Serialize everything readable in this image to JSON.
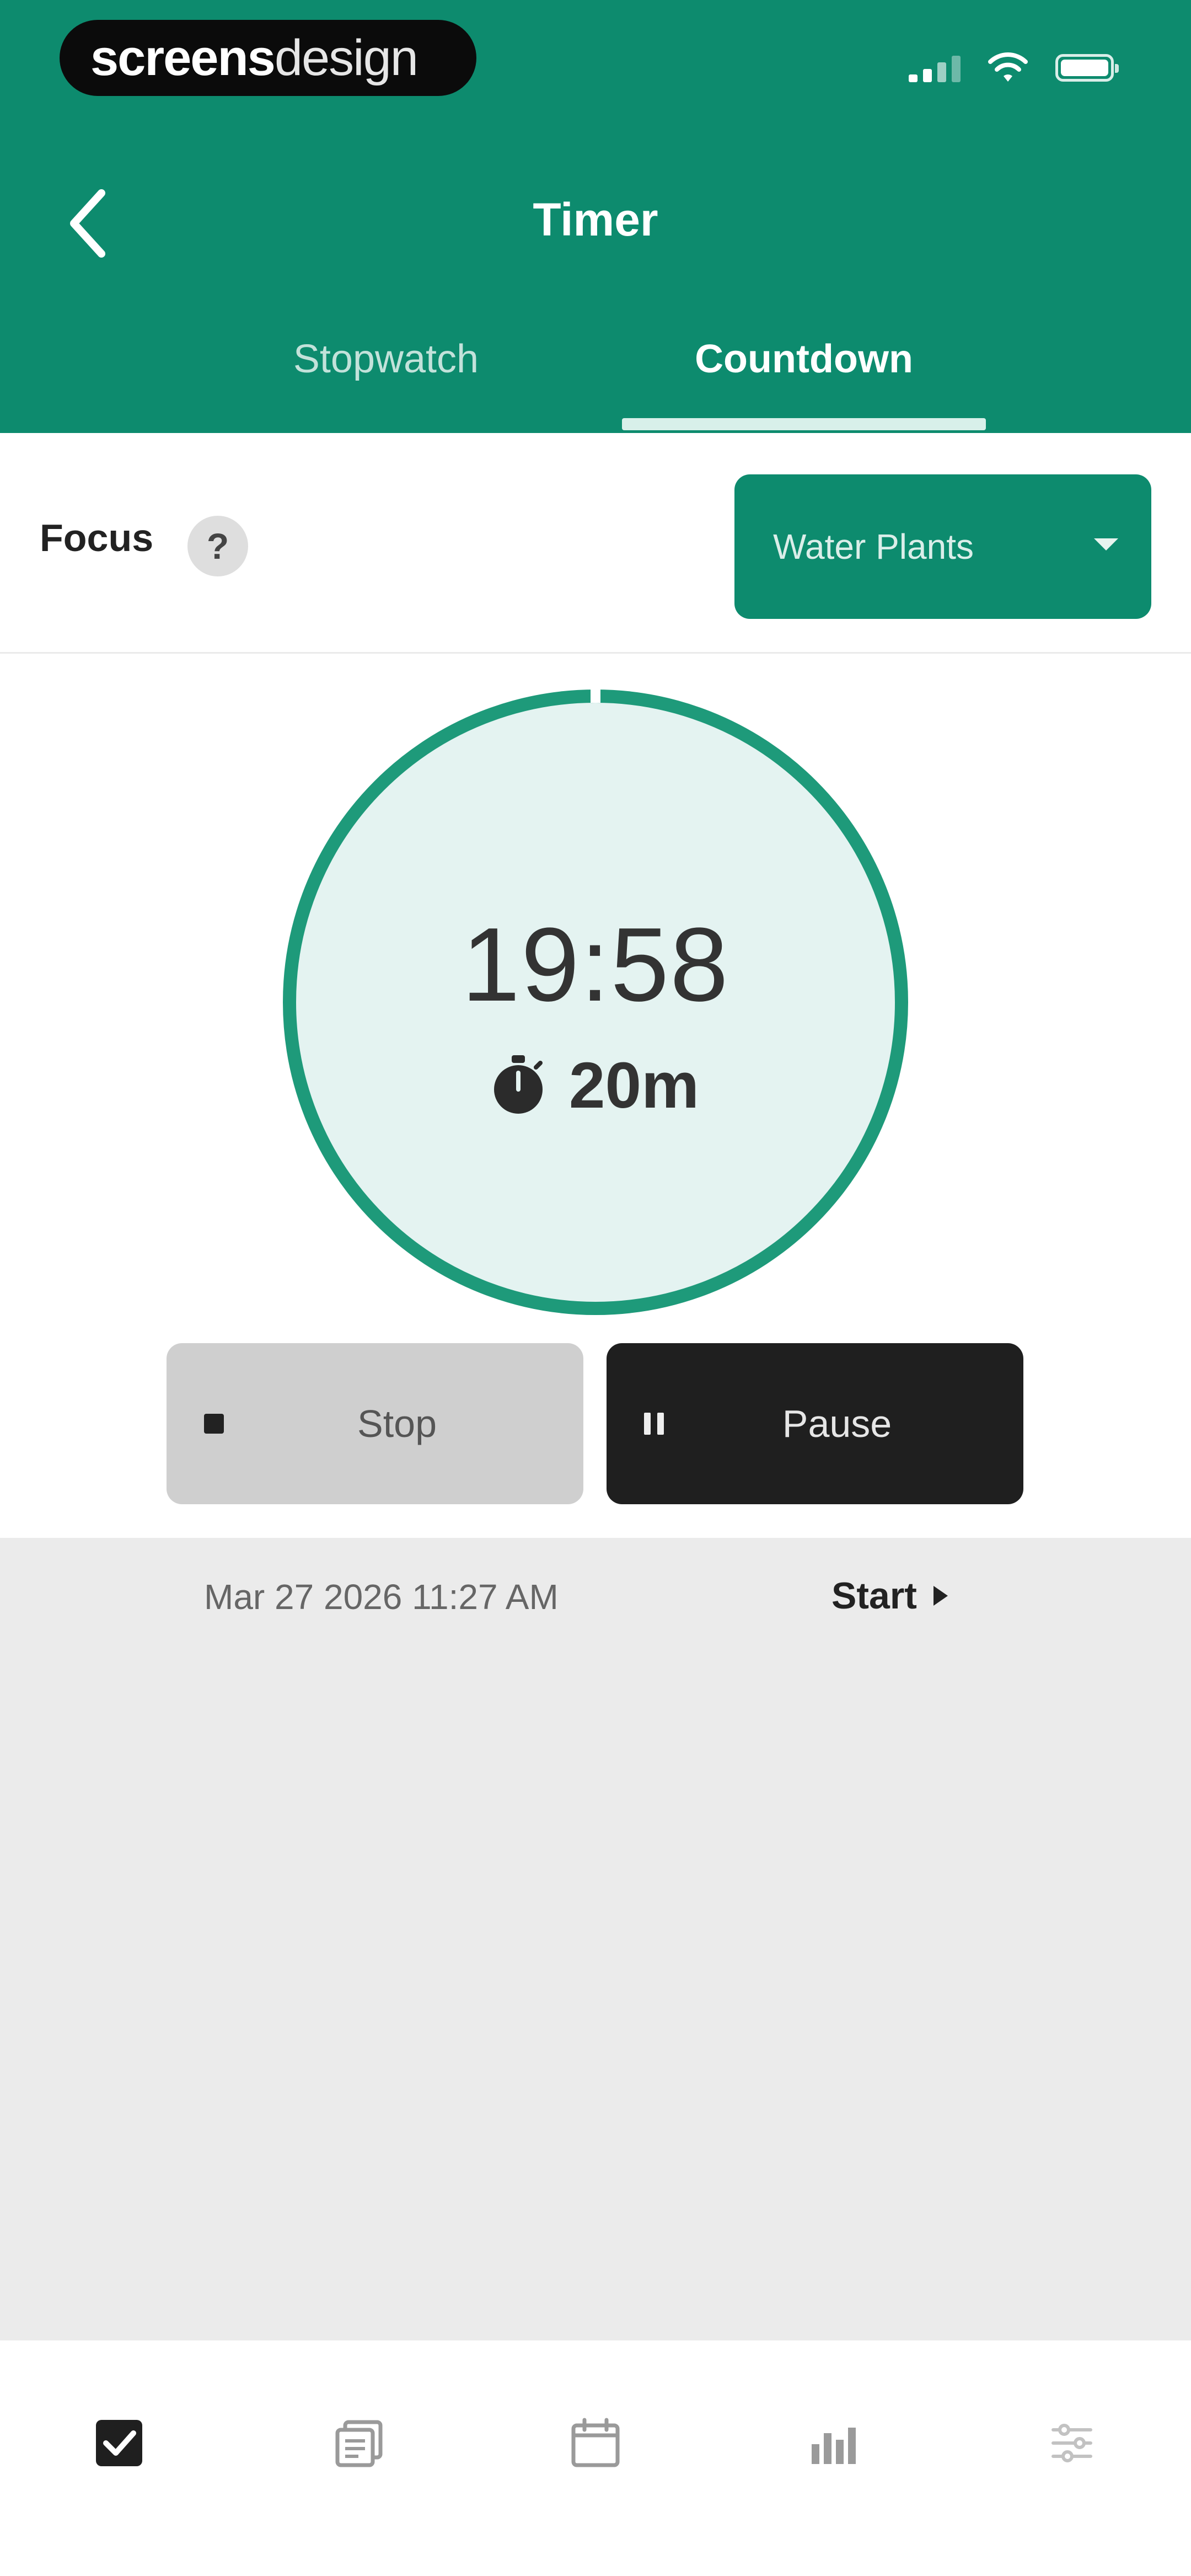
{
  "brand": {
    "part1": "screens",
    "part2": "design"
  },
  "header": {
    "title": "Timer",
    "tabs": [
      {
        "label": "Stopwatch",
        "active": false
      },
      {
        "label": "Countdown",
        "active": true
      }
    ]
  },
  "focus": {
    "label": "Focus",
    "help_glyph": "?",
    "selected_value": "Water Plants"
  },
  "timer": {
    "remaining": "19:58",
    "duration": "20m",
    "progress_fraction": 0.998
  },
  "controls": {
    "stop_label": "Stop",
    "pause_label": "Pause"
  },
  "log": {
    "date": "Mar 27 2026 11:27 AM",
    "action": "Start"
  },
  "nav": {
    "items": [
      "tasks-icon",
      "notes-icon",
      "calendar-icon",
      "stats-icon",
      "settings-icon"
    ]
  },
  "colors": {
    "accent": "#0d8b6e",
    "ring": "#1e9a7a",
    "circle_fill": "#e4f3f1",
    "dark": "#1f1f1f"
  }
}
